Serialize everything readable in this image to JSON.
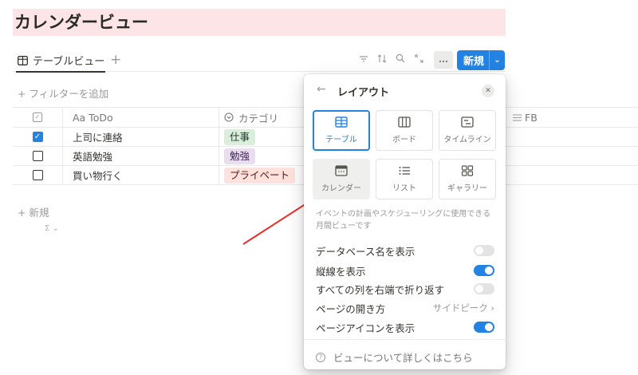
{
  "page": {
    "title": "カレンダービュー"
  },
  "viewbar": {
    "tab_label": "テーブルビュー",
    "add_label": "+",
    "new_label": "新規",
    "new_caret": "⌄"
  },
  "toolbar_icons": [
    "filter-icon",
    "sort-icon",
    "search-icon",
    "expand-icon",
    "more-icon"
  ],
  "filter": {
    "add_label": "+ フィルターを追加"
  },
  "table": {
    "columns": [
      {
        "name": "",
        "icon": "checkbox-icon"
      },
      {
        "name": "Aa ToDo",
        "icon": "text-icon"
      },
      {
        "name": "カテゴリ",
        "icon": "select-icon"
      },
      {
        "name": "FB",
        "icon": "list-icon"
      }
    ],
    "rows": [
      {
        "done": true,
        "todo": "上司に連絡",
        "category": "仕事"
      },
      {
        "done": false,
        "todo": "英語勉強",
        "category": "勉強"
      },
      {
        "done": false,
        "todo": "買い物行く",
        "category": "プライベート"
      }
    ],
    "new_row_label": "+ 新規",
    "sum_label": "Σ ⌄"
  },
  "colors": {
    "accent": "#2383e2",
    "title_bg": "#fde5e7",
    "tag_work": "#dbeddb",
    "tag_study": "#e8deee",
    "tag_private": "#ffe2dd",
    "annotation_arrow": "#e8302b"
  },
  "popover": {
    "back_label": "←",
    "title": "レイアウト",
    "close_label": "✕",
    "layouts": [
      {
        "label": "テーブル",
        "icon": "table-icon",
        "selected": true
      },
      {
        "label": "ボード",
        "icon": "board-icon"
      },
      {
        "label": "タイムライン",
        "icon": "timeline-icon"
      },
      {
        "label": "カレンダー",
        "icon": "calendar-icon",
        "highlighted": true
      },
      {
        "label": "リスト",
        "icon": "list-icon"
      },
      {
        "label": "ギャラリー",
        "icon": "gallery-icon"
      }
    ],
    "description": "イベントの計画やスケジューリングに使用できる月間ビューです",
    "options": [
      {
        "label": "データベース名を表示",
        "on": false
      },
      {
        "label": "縦線を表示",
        "on": true
      },
      {
        "label": "すべての列を右端で折り返す",
        "on": false
      },
      {
        "label": "ページの開き方",
        "value": "サイドピーク ›"
      },
      {
        "label": "ページアイコンを表示",
        "on": true
      }
    ],
    "help_label": "ビューについて詳しくはこちら"
  }
}
